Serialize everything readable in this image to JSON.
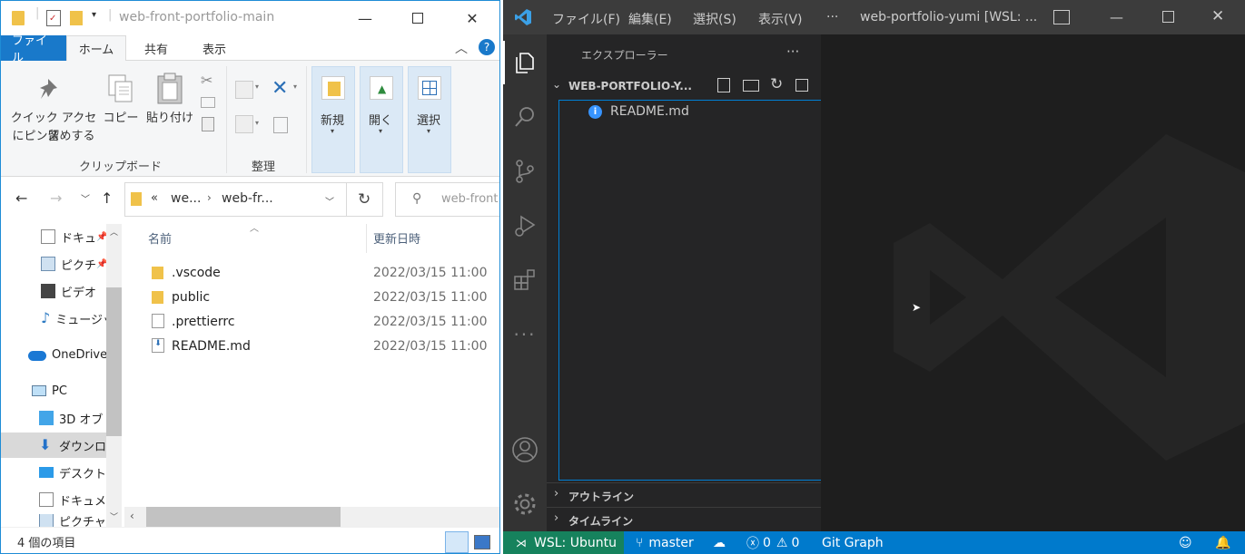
{
  "explorer": {
    "title": "web-front-portfolio-main",
    "tabs": [
      "ファイル",
      "ホーム",
      "共有",
      "表示"
    ],
    "ribbon": {
      "quick_access": "クイック アクセス",
      "quick_access2": "にピン留めする",
      "copy": "コピー",
      "paste": "貼り付け",
      "clipboard_group": "クリップボード",
      "organize_group": "整理",
      "new": "新規",
      "open": "開く",
      "select": "選択"
    },
    "address": {
      "prefix": "«",
      "part1": "we...",
      "part2": "web-fr..."
    },
    "search_placeholder": "web-front",
    "nav": [
      "ドキュ",
      "ピクチ",
      "ビデオ",
      "ミュージッ",
      "OneDrive",
      "PC",
      "3D オブ",
      "ダウンロ",
      "デスクト",
      "ドキュメ",
      "ピクチャ"
    ],
    "columns": {
      "name": "名前",
      "date": "更新日時"
    },
    "files": [
      {
        "name": ".vscode",
        "date": "2022/03/15 11:00",
        "type": "folder"
      },
      {
        "name": "public",
        "date": "2022/03/15 11:00",
        "type": "folder"
      },
      {
        "name": ".prettierrc",
        "date": "2022/03/15 11:00",
        "type": "file"
      },
      {
        "name": "README.md",
        "date": "2022/03/15 11:00",
        "type": "md"
      }
    ],
    "status": "4 個の項目"
  },
  "vscode": {
    "menus": [
      "ファイル(F)",
      "編集(E)",
      "選択(S)",
      "表示(V)",
      "···"
    ],
    "title": "web-portfolio-yumi [WSL: ...",
    "sidebar_title": "エクスプローラー",
    "sidebar_more": "···",
    "folder": "WEB-PORTFOLIO-Y...",
    "file": "README.md",
    "outline": "アウトライン",
    "timeline": "タイムライン",
    "status": {
      "remote": "WSL: Ubuntu",
      "branch": "master",
      "errors": "0",
      "warnings": "0",
      "gitgraph": "Git Graph"
    }
  },
  "colors": {
    "accent": "#007acc",
    "remote_bg": "#16825d",
    "explorer_blue": "#1979ca"
  }
}
